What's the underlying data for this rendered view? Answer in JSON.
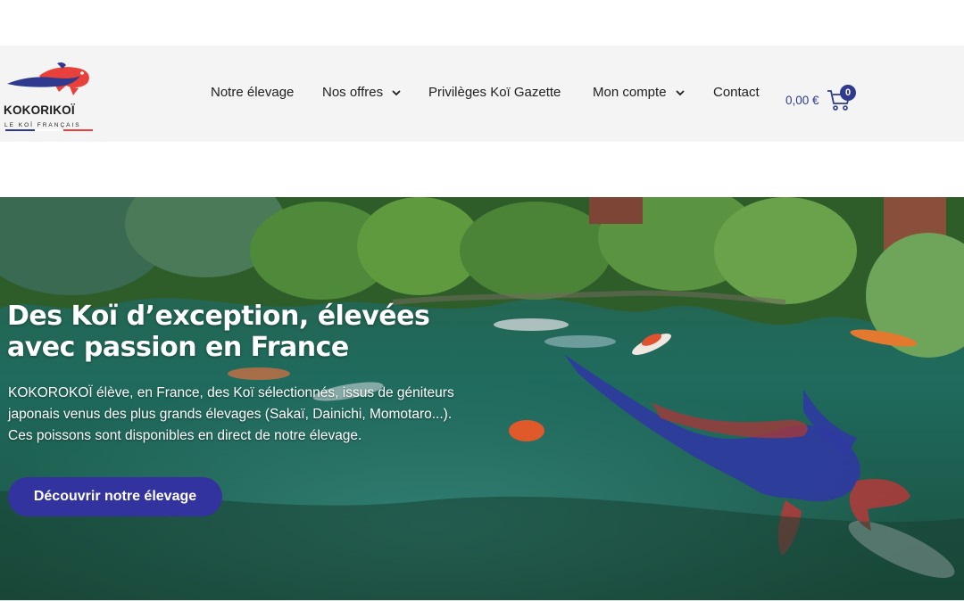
{
  "brand": {
    "name": "KOKORIKOÏ",
    "tagline": "LE KOÏ FRANÇAIS",
    "colors": {
      "blue": "#2f3a8f",
      "red": "#e8413b",
      "white": "#ffffff"
    }
  },
  "nav": {
    "items": [
      {
        "label": "Notre élevage",
        "has_dropdown": false
      },
      {
        "label": "Nos offres",
        "has_dropdown": true
      },
      {
        "label": "Privilèges Koï Gazette",
        "has_dropdown": false
      },
      {
        "label": "Mon compte",
        "has_dropdown": true
      },
      {
        "label": "Contact",
        "has_dropdown": false
      }
    ]
  },
  "cart": {
    "total": "0,00 €",
    "count": "0",
    "icon": "cart-icon"
  },
  "hero": {
    "title": "Des Koï d’exception, élevées avec passion en France",
    "text": "KOKOROKOÏ élève, en France, des Koï sélectionnés, issus de géniteurs japonais venus des plus grands élevages (Sakaï, Dainichi, Momotaro...). Ces poissons sont disponibles en direct de notre élevage.",
    "cta_label": "Découvrir notre élevage"
  }
}
